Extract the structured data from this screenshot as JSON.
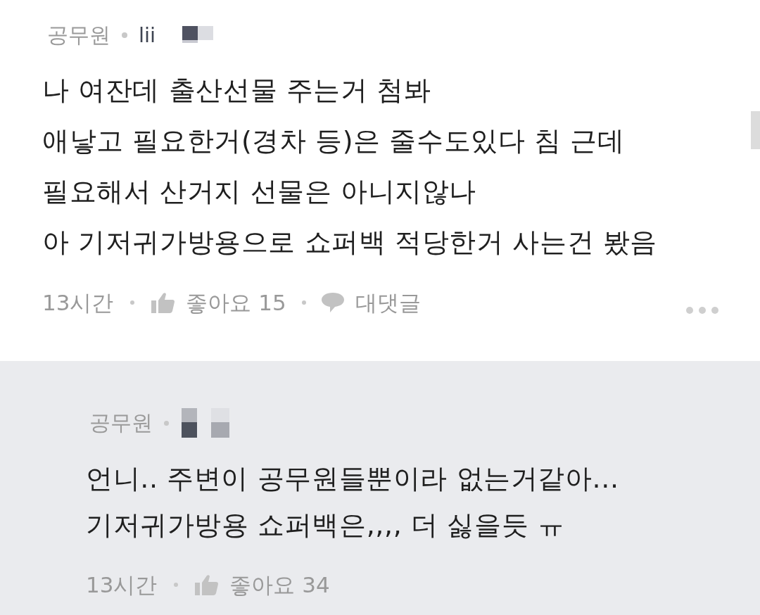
{
  "comment": {
    "author": "공무원",
    "handle": "lii",
    "lines": [
      "나 여잔데 출산선물 주는거 첨봐",
      "애낳고 필요한거(경차 등)은 줄수도있다 침 근데",
      "필요해서 산거지 선물은 아니지않나",
      "아 기저귀가방용으로 쇼퍼백 적당한거 사는건 봤음"
    ],
    "time": "13시간",
    "like_label": "좋아요 15",
    "reply_label": "대댓글"
  },
  "reply": {
    "author": "공무원",
    "lines": [
      "언니.. 주변이 공무원들뿐이라 없는거같아...",
      "기저귀가방용 쇼퍼백은,,,, 더 싫을듯 ㅠ"
    ],
    "time": "13시간",
    "like_label": "좋아요 34"
  }
}
